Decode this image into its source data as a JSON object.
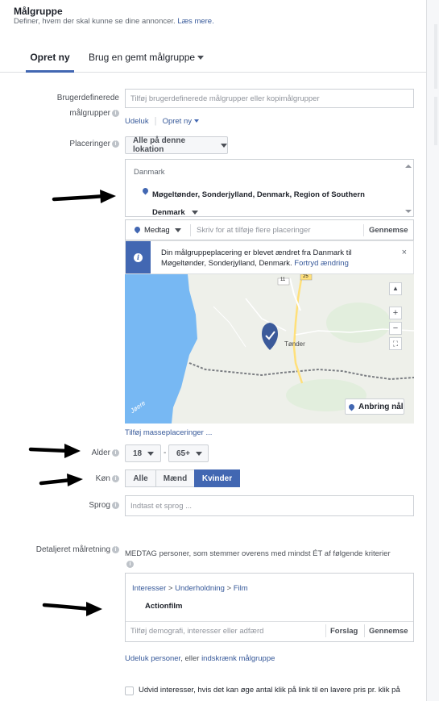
{
  "header": {
    "title": "Målgruppe",
    "subtitle": "Definer, hvem der skal kunne se dine annoncer.",
    "learn_more": "Læs mere."
  },
  "tabs": {
    "create_new": "Opret ny",
    "use_saved": "Brug en gemt målgruppe"
  },
  "custom_audiences": {
    "label_line1": "Brugerdefinerede",
    "label_line2": "målgrupper",
    "placeholder": "Tilføj brugerdefinerede målgrupper eller kopimålgrupper",
    "exclude": "Udeluk",
    "create_new": "Opret ny"
  },
  "locations": {
    "label": "Placeringer",
    "dropdown_value": "Alle på denne lokation",
    "country": "Danmark",
    "selected_location": "Møgeltønder, Sonderjylland, Denmark, Region of Southern Denmark",
    "include_value": "Medtag",
    "search_placeholder": "Skriv for at tilføje flere placeringer",
    "browse": "Gennemse",
    "notice_text": "Din målgruppeplacering er blevet ændret fra Danmark til Møgeltønder, Sonderjylland, Denmark.",
    "undo_change": "Fortryd ændring",
    "map_town": "Tønder",
    "map_road_11": "11",
    "map_road_25": "25",
    "map_water": "Jøere",
    "drop_pin": "Anbring nål",
    "bulk_add": "Tilføj masseplaceringer ..."
  },
  "age": {
    "label": "Alder",
    "min": "18",
    "separator": "-",
    "max": "65+"
  },
  "gender": {
    "label": "Køn",
    "options": [
      "Alle",
      "Mænd",
      "Kvinder"
    ],
    "selected": "Kvinder"
  },
  "languages": {
    "label": "Sprog",
    "placeholder": "Indtast et sprog ..."
  },
  "detailed_targeting": {
    "label": "Detaljeret målretning",
    "description": "MEDTAG personer, som stemmer overens med mindst ÉT af følgende kriterier",
    "breadcrumb": [
      "Interesser",
      "Underholdning",
      "Film"
    ],
    "item": "Actionfilm",
    "search_placeholder": "Tilføj demografi, interesser eller adfærd",
    "suggestions": "Forslag",
    "browse": "Gennemse",
    "exclude_people": "Udeluk personer",
    "or_text": ", eller ",
    "narrow": "indskrænk målgruppe",
    "expand_text": "Udvid interesser, hvis det kan øge antal klik på link til en lavere pris pr. klik på"
  },
  "colors": {
    "accent": "#4267b2",
    "link": "#365899",
    "water": "#77b8f3"
  }
}
